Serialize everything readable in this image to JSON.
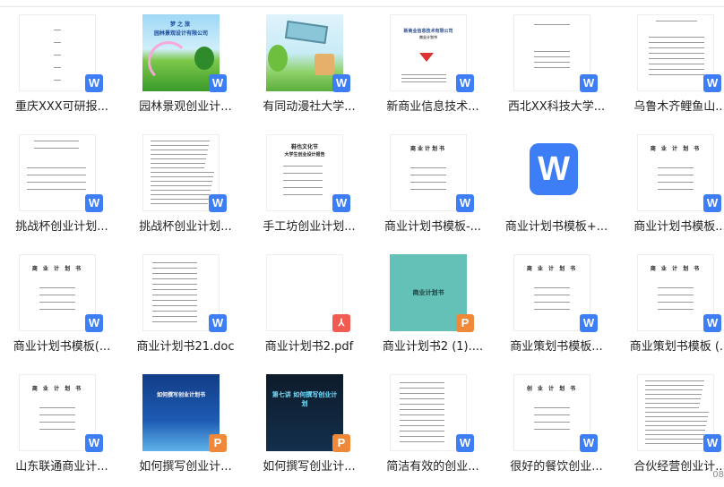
{
  "files": [
    {
      "name": "重庆XXX可研报...",
      "type": "w",
      "thumb": "doc-vertical"
    },
    {
      "name": "园林景观创业计...",
      "type": "w",
      "thumb": "garden",
      "title": "梦之旅",
      "subtitle": "园林景观设计有限公司"
    },
    {
      "name": "有同动漫社大学...",
      "type": "w",
      "thumb": "cartoon"
    },
    {
      "name": "新商业信息技术...",
      "type": "w",
      "thumb": "doc-company",
      "title": "新商业信息技术有限公司",
      "subtitle": "商业计划书"
    },
    {
      "name": "西北XX科技大学...",
      "type": "w",
      "thumb": "doc-plain"
    },
    {
      "name": "乌鲁木齐鲤鱼山...",
      "type": "w",
      "thumb": "doc-table"
    },
    {
      "name": "挑战杯创业计划...",
      "type": "w",
      "thumb": "doc-lines"
    },
    {
      "name": "挑战杯创业计划...",
      "type": "w",
      "thumb": "doc-dense"
    },
    {
      "name": "手工坊创业计划...",
      "type": "w",
      "thumb": "doc-form",
      "title": "鞋也文化节",
      "subtitle": "大学生创业设计报告"
    },
    {
      "name": "商业计划书模板-...",
      "type": "w",
      "thumb": "doc-title",
      "title": "商业计划书"
    },
    {
      "name": "商业计划书模板+...",
      "type": "w",
      "thumb": "big-w",
      "letter": "W"
    },
    {
      "name": "商业计划书模板...",
      "type": "w",
      "thumb": "doc-title",
      "title": "商 业 计 划 书"
    },
    {
      "name": "商业计划书模板(...",
      "type": "w",
      "thumb": "doc-title",
      "title": "商 业 计 划 书"
    },
    {
      "name": "商业计划书21.doc",
      "type": "w",
      "thumb": "doc-list"
    },
    {
      "name": "商业计划书2.pdf",
      "type": "pdf",
      "thumb": "blank"
    },
    {
      "name": "商业计划书2 (1)....",
      "type": "p",
      "thumb": "teal",
      "title": "商业计划书"
    },
    {
      "name": "商业策划书模板...",
      "type": "w",
      "thumb": "doc-title",
      "title": "商 业 计 划 书"
    },
    {
      "name": "商业策划书模板 (...",
      "type": "w",
      "thumb": "doc-title",
      "title": "商 业 计 划 书"
    },
    {
      "name": "山东联通商业计...",
      "type": "w",
      "thumb": "doc-title",
      "title": "商 业 计 划 书"
    },
    {
      "name": "如何撰写创业计...",
      "type": "p",
      "thumb": "blue-slide",
      "title": "如何撰写创业计划书"
    },
    {
      "name": "如何撰写创业计...",
      "type": "p",
      "thumb": "dark-slide",
      "title": "第七讲 如何撰写创业计划"
    },
    {
      "name": "简洁有效的创业...",
      "type": "w",
      "thumb": "doc-list"
    },
    {
      "name": "很好的餐饮创业...",
      "type": "w",
      "thumb": "doc-title",
      "title": "创 业 计 划 书"
    },
    {
      "name": "合伙经营创业计...",
      "type": "w",
      "thumb": "doc-dense"
    }
  ],
  "badges": {
    "w": "W",
    "pdf": "⅄",
    "p": "P"
  },
  "scroll_hint": "08"
}
